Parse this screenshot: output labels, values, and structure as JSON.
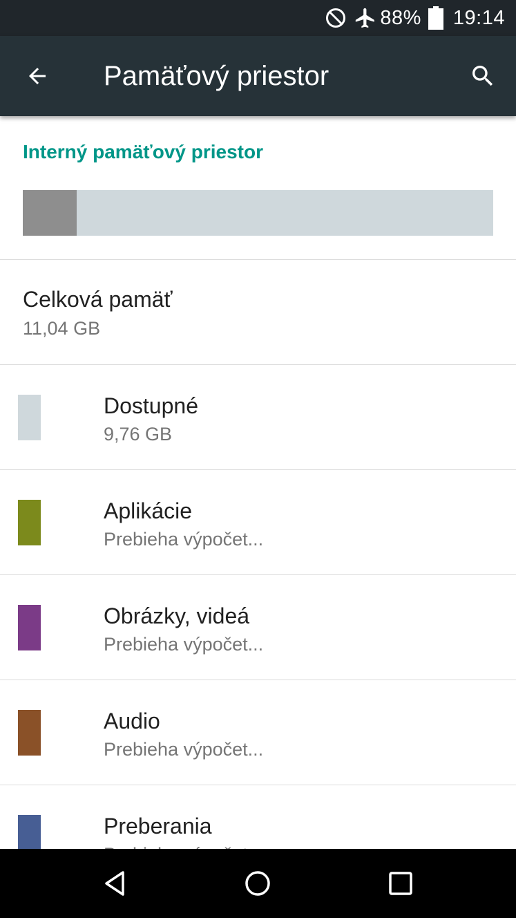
{
  "status_bar": {
    "battery": "88%",
    "time": "19:14"
  },
  "app_bar": {
    "title": "Pamäťový priestor"
  },
  "storage": {
    "section_header": "Interný pamäťový priestor",
    "used_fraction": 0.115,
    "used_color": "#8e8e8e",
    "free_color": "#cfd8dc",
    "total_label": "Celková pamäť",
    "total_value": "11,04 GB",
    "categories": [
      {
        "label": "Dostupné",
        "value": "9,76 GB",
        "color": "#cfd8dc"
      },
      {
        "label": "Aplikácie",
        "value": "Prebieha výpočet...",
        "color": "#7c8a1c"
      },
      {
        "label": "Obrázky, videá",
        "value": "Prebieha výpočet...",
        "color": "#7b3b87"
      },
      {
        "label": "Audio",
        "value": "Prebieha výpočet...",
        "color": "#8a5128"
      },
      {
        "label": "Preberania",
        "value": "Prebieha výpočet...",
        "color": "#475e94"
      }
    ]
  },
  "icons": {
    "status": [
      "do-not-disturb-icon",
      "airplane-mode-icon",
      "battery-icon"
    ],
    "app_bar": [
      "back-arrow-icon",
      "search-icon"
    ],
    "nav": [
      "back-triangle-icon",
      "home-circle-icon",
      "recents-square-icon"
    ]
  },
  "colors": {
    "status_bar": "#20262b",
    "app_bar": "#263238",
    "accent": "#009688"
  }
}
